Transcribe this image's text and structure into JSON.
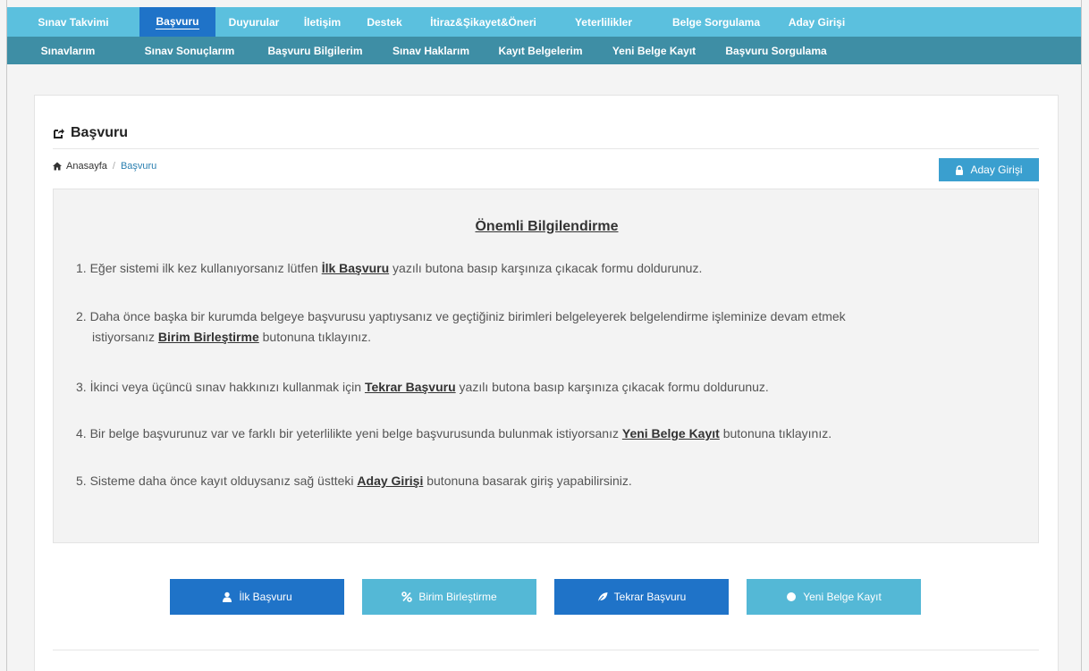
{
  "colors": {
    "topnav_bg": "#5bc0de",
    "subnav_bg": "#3e8ea5",
    "active_tab": "#1f73c8",
    "primary_button": "#1f73c8",
    "info_button": "#54b8d6",
    "aday_button": "#3a9fcf",
    "link": "#2a7fb0"
  },
  "topnav": {
    "items": [
      {
        "label": "Sınav Takvimi"
      },
      {
        "label": "Başvuru",
        "active": true
      },
      {
        "label": "Duyurular"
      },
      {
        "label": "İletişim"
      },
      {
        "label": "Destek"
      },
      {
        "label": "İtiraz&Şikayet&Öneri"
      },
      {
        "label": "Yeterlilikler"
      },
      {
        "label": "Belge Sorgulama"
      },
      {
        "label": "Aday Girişi"
      }
    ]
  },
  "subnav": {
    "items": [
      {
        "label": "Sınavlarım"
      },
      {
        "label": "Sınav Sonuçlarım"
      },
      {
        "label": "Başvuru Bilgilerim"
      },
      {
        "label": "Sınav Haklarım"
      },
      {
        "label": "Kayıt Belgelerim"
      },
      {
        "label": "Yeni Belge Kayıt"
      },
      {
        "label": "Başvuru Sorgulama"
      }
    ]
  },
  "page": {
    "title": "Başvuru",
    "title_icon": "share-square-icon"
  },
  "breadcrumb": {
    "home_icon": "home-icon",
    "home": "Anasayfa",
    "separator": "/",
    "current": "Başvuru"
  },
  "aday_button": {
    "label": "Aday Girişi",
    "icon": "lock-icon"
  },
  "info": {
    "heading": "Önemli Bilgilendirme",
    "items": [
      {
        "num": "1.",
        "pre": "Eğer sistemi ilk kez kullanıyorsanız lütfen ",
        "bold": "İlk Başvuru",
        "post": " yazılı butona basıp karşınıza çıkacak formu doldurunuz."
      },
      {
        "num": "2.",
        "line1": "Daha önce başka bir kurumda belgeye başvurusu yaptıysanız ve geçtiğiniz birimleri belgeleyerek belgelendirme işleminize devam etmek",
        "pre": "istiyorsanız ",
        "bold": "Birim Birleştirme",
        "post": " butonuna tıklayınız."
      },
      {
        "num": "3.",
        "pre": "İkinci veya üçüncü sınav hakkınızı kullanmak için ",
        "bold": "Tekrar Başvuru",
        "post": " yazılı butona basıp karşınıza çıkacak formu doldurunuz."
      },
      {
        "num": "4.",
        "pre": "Bir belge başvurunuz var ve farklı bir yeterlilikte yeni belge başvurusunda bulunmak istiyorsanız ",
        "bold": "Yeni Belge Kayıt",
        "post": " butonuna tıklayınız."
      },
      {
        "num": "5.",
        "pre": "Sisteme daha önce kayıt olduysanız sağ üstteki ",
        "bold": "Aday Girişi",
        "post": " butonuna basarak giriş yapabilirsiniz."
      }
    ]
  },
  "buttons": [
    {
      "label": "İlk Başvuru",
      "icon": "user-icon",
      "style": "primary"
    },
    {
      "label": "Birim Birleştirme",
      "icon": "percent-icon",
      "style": "info"
    },
    {
      "label": "Tekrar Başvuru",
      "icon": "leaf-icon",
      "style": "primary"
    },
    {
      "label": "Yeni Belge Kayıt",
      "icon": "circle-icon",
      "style": "info"
    }
  ]
}
